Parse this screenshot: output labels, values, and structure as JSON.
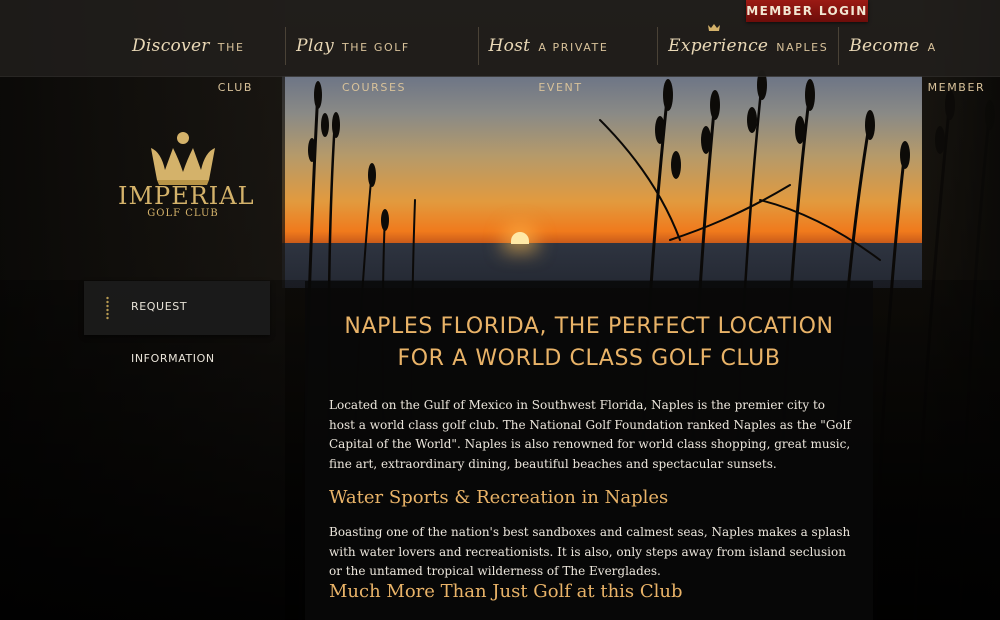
{
  "header": {
    "member_login": "MEMBER LOGIN",
    "nav": [
      {
        "script": "Discover",
        "caps": "THE CLUB"
      },
      {
        "script": "Play",
        "caps": "THE GOLF COURSES"
      },
      {
        "script": "Host",
        "caps": "A PRIVATE EVENT"
      },
      {
        "script": "Experience",
        "caps": "NAPLES"
      },
      {
        "script": "Become",
        "caps": "A MEMBER"
      }
    ]
  },
  "logo": {
    "name": "IMPERIAL",
    "subtitle": "GOLF CLUB",
    "icon": "crown-icon"
  },
  "sidebar": {
    "request_label": "REQUEST INFORMATION"
  },
  "main": {
    "headline_line1": "NAPLES FLORIDA, THE PERFECT LOCATION",
    "headline_line2": "FOR A WORLD CLASS GOLF CLUB",
    "paragraph1": "Located on the Gulf of Mexico in Southwest Florida, Naples is the premier city to host a world class golf club. The National Golf Foundation ranked Naples as the \"Golf Capital of the World\". Naples is also renowned for world class shopping, great music, fine art, extraordinary dining, beautiful beaches and spectacular sunsets.",
    "subheading1": "Water Sports & Recreation in Naples",
    "paragraph2": "Boasting one of the nation's best sandboxes and calmest seas, Naples makes a splash with water lovers and recreationists. It is also, only steps away from island seclusion or the untamed tropical wilderness of The Everglades.",
    "subheading2": "Much More Than Just Golf at this Club"
  },
  "colors": {
    "accent": "#e9b368",
    "gold": "#d4b26a",
    "login_red": "#8b1510",
    "nav_text": "#d8c29a"
  }
}
